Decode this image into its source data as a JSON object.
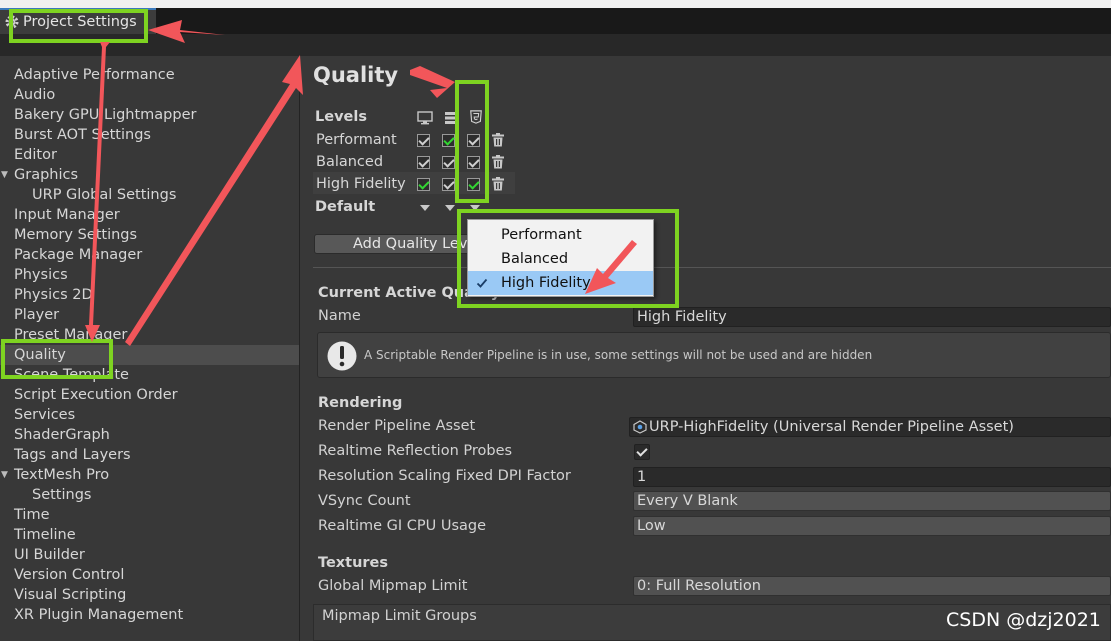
{
  "window": {
    "tab_title": "Project Settings"
  },
  "sidebar": {
    "items": [
      {
        "label": "Adaptive Performance"
      },
      {
        "label": "Audio"
      },
      {
        "label": "Bakery GPU Lightmapper"
      },
      {
        "label": "Burst AOT Settings"
      },
      {
        "label": "Editor"
      },
      {
        "label": "Graphics",
        "expanded": true
      },
      {
        "label": "URP Global Settings",
        "child": true
      },
      {
        "label": "Input Manager"
      },
      {
        "label": "Memory Settings"
      },
      {
        "label": "Package Manager"
      },
      {
        "label": "Physics"
      },
      {
        "label": "Physics 2D"
      },
      {
        "label": "Player"
      },
      {
        "label": "Preset Manager"
      },
      {
        "label": "Quality",
        "selected": true
      },
      {
        "label": "Scene Template"
      },
      {
        "label": "Script Execution Order"
      },
      {
        "label": "Services"
      },
      {
        "label": "ShaderGraph"
      },
      {
        "label": "Tags and Layers"
      },
      {
        "label": "TextMesh Pro",
        "expanded": true
      },
      {
        "label": "Settings",
        "child": true
      },
      {
        "label": "Time"
      },
      {
        "label": "Timeline"
      },
      {
        "label": "UI Builder"
      },
      {
        "label": "Version Control"
      },
      {
        "label": "Visual Scripting"
      },
      {
        "label": "XR Plugin Management"
      }
    ]
  },
  "quality": {
    "title": "Quality",
    "levels_label": "Levels",
    "platform_icons": [
      "monitor-icon",
      "server-icon",
      "html5-icon"
    ],
    "levels": [
      {
        "name": "Performant"
      },
      {
        "name": "Balanced"
      },
      {
        "name": "High Fidelity"
      }
    ],
    "default_label": "Default",
    "add_button_label": "Add Quality Level",
    "current_section_title": "Current Active Quality Level",
    "name_label": "Name",
    "name_value": "High Fidelity",
    "help_text": "A Scriptable Render Pipeline is in use, some settings will not be used and are hidden",
    "rendering_title": "Rendering",
    "render_pipeline_label": "Render Pipeline Asset",
    "render_pipeline_value": "URP-HighFidelity (Universal Render Pipeline Asset)",
    "reflection_probes_label": "Realtime Reflection Probes",
    "dpi_label": "Resolution Scaling Fixed DPI Factor",
    "dpi_value": "1",
    "vsync_label": "VSync Count",
    "vsync_value": "Every V Blank",
    "gi_label": "Realtime GI CPU Usage",
    "gi_value": "Low",
    "textures_title": "Textures",
    "mipmap_label": "Global Mipmap Limit",
    "mipmap_value": "0: Full Resolution",
    "mipmap_groups_label": "Mipmap Limit Groups"
  },
  "popup": {
    "options": [
      "Performant",
      "Balanced",
      "High Fidelity"
    ],
    "selected": "High Fidelity"
  },
  "annotation_color": "#7ed321",
  "arrow_color": "#f2565a",
  "watermark": "CSDN @dzj2021"
}
